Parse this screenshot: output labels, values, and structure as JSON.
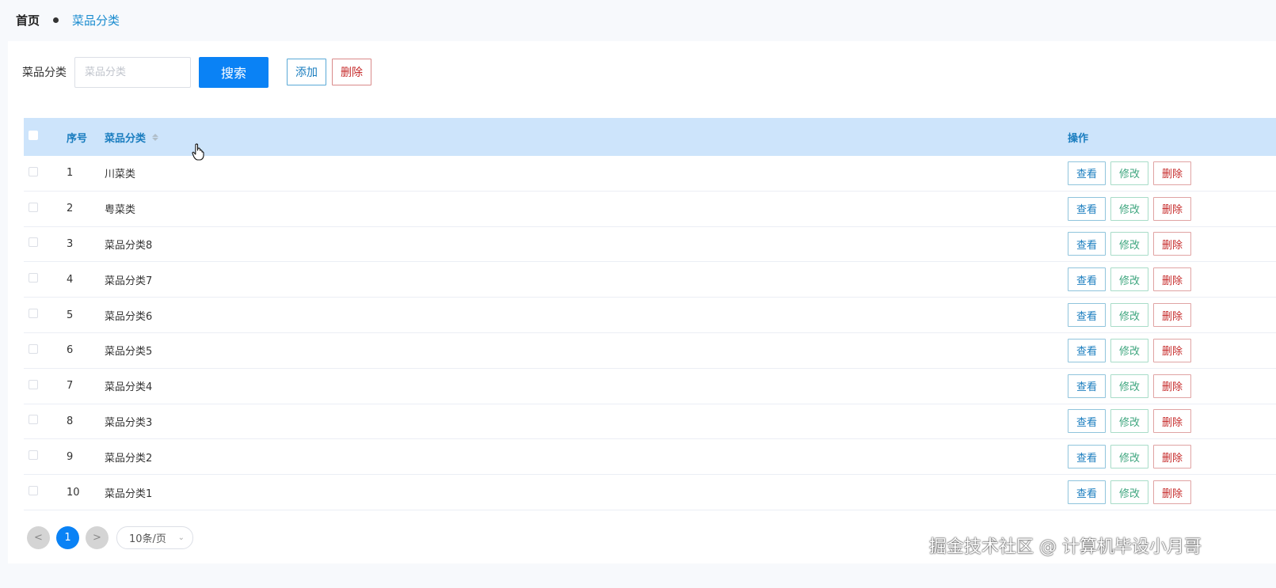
{
  "breadcrumb": {
    "home": "首页",
    "current": "菜品分类"
  },
  "search": {
    "label": "菜品分类",
    "placeholder": "菜品分类",
    "value": "",
    "search_label": "搜索",
    "add_label": "添加",
    "delete_label": "删除"
  },
  "table": {
    "headers": {
      "no": "序号",
      "name": "菜品分类",
      "ops": "操作"
    },
    "ops": {
      "view": "查看",
      "edit": "修改",
      "delete": "删除"
    },
    "rows": [
      {
        "no": "1",
        "name": "川菜类"
      },
      {
        "no": "2",
        "name": "粤菜类"
      },
      {
        "no": "3",
        "name": "菜品分类8"
      },
      {
        "no": "4",
        "name": "菜品分类7"
      },
      {
        "no": "5",
        "name": "菜品分类6"
      },
      {
        "no": "6",
        "name": "菜品分类5"
      },
      {
        "no": "7",
        "name": "菜品分类4"
      },
      {
        "no": "8",
        "name": "菜品分类3"
      },
      {
        "no": "9",
        "name": "菜品分类2"
      },
      {
        "no": "10",
        "name": "菜品分类1"
      }
    ]
  },
  "pagination": {
    "prev": "<",
    "current": "1",
    "next": ">",
    "page_size": "10条/页"
  },
  "watermark": "掘金技术社区 @ 计算机毕设小月哥",
  "colors": {
    "primary": "#0a82f5",
    "header_bg": "#cde4fb",
    "link": "#1a8ccf",
    "danger": "#c62a2a",
    "success": "#3fa67f"
  }
}
